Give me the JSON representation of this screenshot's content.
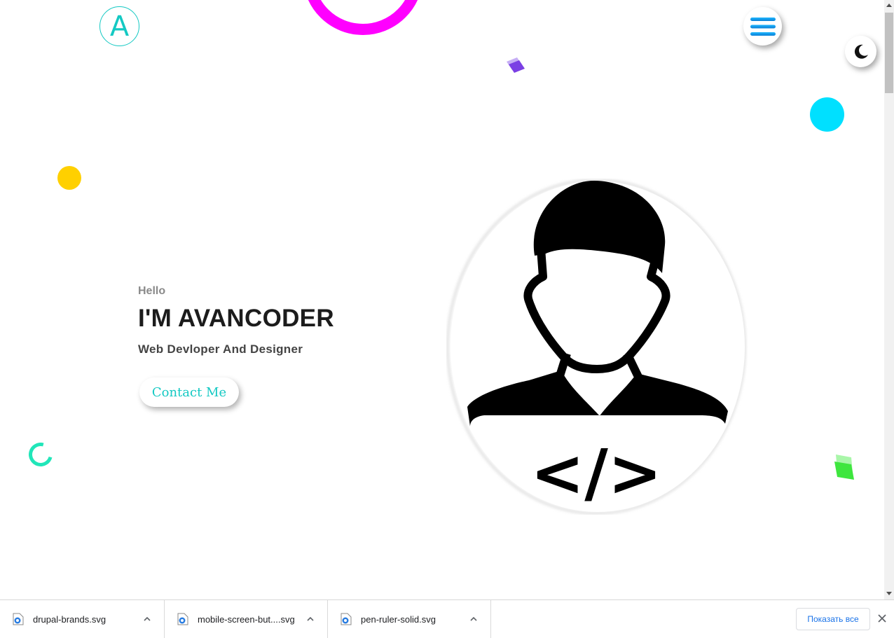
{
  "header": {
    "logo_letter": "A",
    "menu_icon": "hamburger-icon",
    "theme_icon": "moon-icon"
  },
  "hero": {
    "greeting": "Hello",
    "title": "I'M AVANCODER",
    "subtitle": "Web Devloper And Designer",
    "cta_label": "Contact Me",
    "avatar_code_glyph": "</>"
  },
  "colors": {
    "accent": "#14c9c3",
    "magenta": "#ff00ff",
    "yellow": "#ffd000",
    "cyan": "#00e0ff",
    "purple": "#7b3fe4",
    "green": "#3ee63e"
  },
  "downloads": {
    "items": [
      {
        "name": "drupal-brands.svg",
        "icon": "file-icon"
      },
      {
        "name": "mobile-screen-but....svg",
        "icon": "file-icon"
      },
      {
        "name": "pen-ruler-solid.svg",
        "icon": "file-icon"
      }
    ],
    "show_all_label": "Показать все"
  }
}
